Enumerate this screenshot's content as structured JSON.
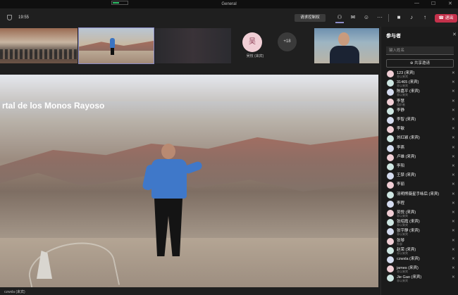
{
  "window": {
    "title": "General",
    "controls": [
      "—",
      "☐",
      "✕"
    ]
  },
  "toolbar": {
    "time": "19:55",
    "request_control": "请求控制权",
    "icons": [
      "people-icon",
      "chat-icon",
      "reaction-icon",
      "more-icon",
      "camera-icon",
      "mic-icon",
      "share-icon"
    ],
    "icon_glyphs": [
      "⚇",
      "✉",
      "☺",
      "···",
      "■",
      "♪",
      "↑"
    ],
    "leave": "☎ 退出"
  },
  "thumbnails": {
    "avatar_initial": "吴",
    "avatar_name": "吴枝 (来宾)",
    "more_count": "+18"
  },
  "stage": {
    "caption": "rtal de los Monos Rayoso",
    "presenter_name": "czwxla (来宾)"
  },
  "panel": {
    "title": "参与者",
    "close": "✕",
    "search_placeholder": "键入姓名",
    "share_invite": "⊕ 共享邀请",
    "participants": [
      {
        "name": "123 (来宾)",
        "sub": "非以来宾"
      },
      {
        "name": "31465 (来宾)",
        "sub": "非以来宾"
      },
      {
        "name": "陈嘉平 (来宾)",
        "sub": "非以来宾"
      },
      {
        "name": "李慧",
        "sub": "组织者"
      },
      {
        "name": "李静",
        "sub": ""
      },
      {
        "name": "李智 (来宾)",
        "sub": ""
      },
      {
        "name": "李敏",
        "sub": ""
      },
      {
        "name": "刘红颖 (来宾)",
        "sub": ""
      },
      {
        "name": "李燕",
        "sub": ""
      },
      {
        "name": "卢雄 (来宾)",
        "sub": ""
      },
      {
        "name": "李阳",
        "sub": ""
      },
      {
        "name": "王禁 (来宾)",
        "sub": ""
      },
      {
        "name": "李丽",
        "sub": ""
      },
      {
        "name": "羽明熊薇星手咏后 (来宾)",
        "sub": ""
      },
      {
        "name": "李程",
        "sub": ""
      },
      {
        "name": "吴悦 (来宾)",
        "sub": "非以来宾"
      },
      {
        "name": "张绍霞 (来宾)",
        "sub": "非以来宾"
      },
      {
        "name": "张宇静 (来宾)",
        "sub": "非以来宾"
      },
      {
        "name": "张琴",
        "sub": "外部"
      },
      {
        "name": "赵荣 (来宾)",
        "sub": "非以来宾"
      },
      {
        "name": "czwxla (来宾)",
        "sub": ""
      },
      {
        "name": "james (来宾)",
        "sub": "非以来宾"
      },
      {
        "name": "Jie Gao (来宾)",
        "sub": "非以来宾"
      }
    ]
  }
}
